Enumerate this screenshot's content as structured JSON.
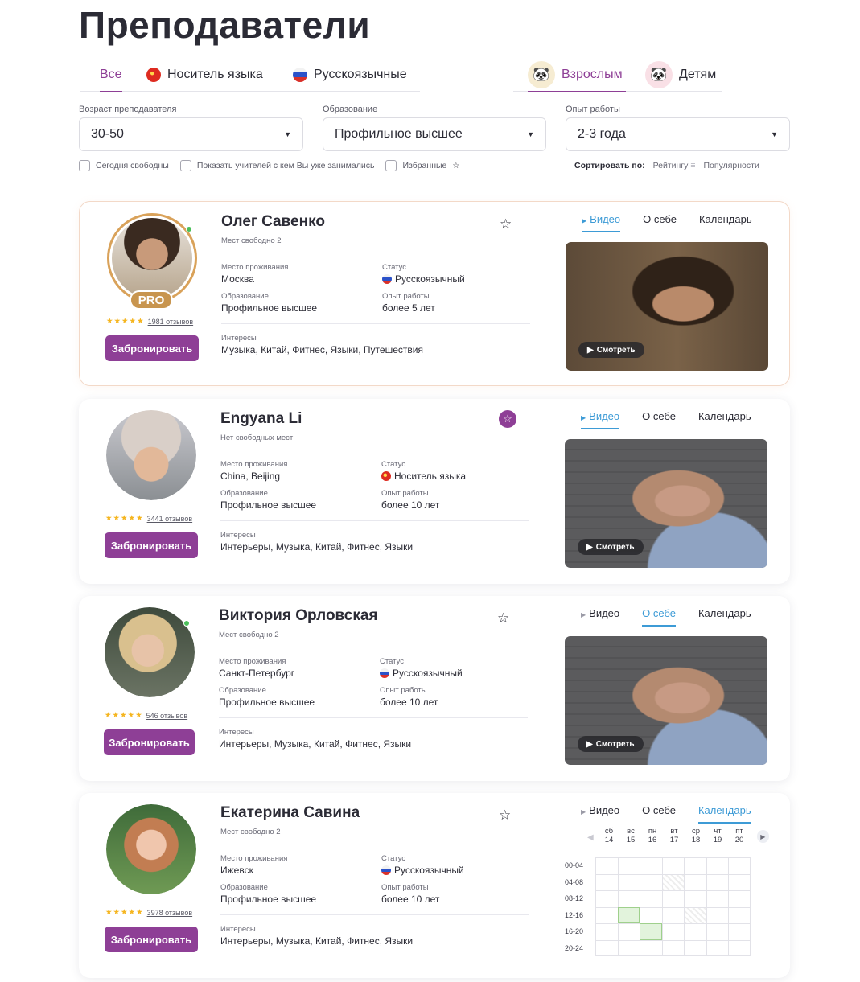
{
  "page_title": "Преподаватели",
  "tabs_left": [
    {
      "label": "Все",
      "active": true,
      "flag": ""
    },
    {
      "label": "Носитель языка",
      "active": false,
      "flag": "cn"
    },
    {
      "label": "Русскоязычные",
      "active": false,
      "flag": "ru"
    }
  ],
  "tabs_right": [
    {
      "label": "Взрослым",
      "active": true,
      "icon": "panda-adult-icon"
    },
    {
      "label": "Детям",
      "active": false,
      "icon": "panda-kid-icon"
    }
  ],
  "filters": {
    "age": {
      "label": "Возраст преподавателя",
      "value": "30-50"
    },
    "education": {
      "label": "Образование",
      "value": "Профильное высшее"
    },
    "experience": {
      "label": "Опыт работы",
      "value": "2-3 года"
    }
  },
  "checkboxes": {
    "free_today": "Сегодня свободны",
    "studied_before": "Показать учителей с кем Вы уже занимались",
    "favorites": "Избранные"
  },
  "sort": {
    "label": "Сортировать по:",
    "rating": "Рейтингу",
    "popularity": "Популярности"
  },
  "labels": {
    "residence": "Место проживания",
    "status": "Статус",
    "education": "Образование",
    "experience": "Опыт работы",
    "interests": "Интересы",
    "book": "Забронировать",
    "watch": "Смотреть",
    "tab_video": "Видео",
    "tab_about": "О себе",
    "tab_calendar": "Календарь"
  },
  "teachers": [
    {
      "name": "Олег Савенко",
      "slots": "Мест свободно 2",
      "pro": true,
      "pro_label": "PRO",
      "online": true,
      "favorite": false,
      "stars": "★★★★★",
      "reviews": "1981 отзывов",
      "residence": "Москва",
      "status": "Русскоязычный",
      "status_flag": "ru",
      "education": "Профильное высшее",
      "experience": "более 5 лет",
      "interests": "Музыка, Китай, Фитнес, Языки, Путешествия",
      "active_tab": "video"
    },
    {
      "name": "Engyana Li",
      "slots": "Нет свободных мест",
      "pro": false,
      "online": false,
      "favorite": true,
      "stars": "★★★★★",
      "reviews": "3441 отзывов",
      "residence": "China, Beijing",
      "status": "Носитель языка",
      "status_flag": "cn",
      "education": "Профильное высшее",
      "experience": "более 10 лет",
      "interests": "Интерьеры, Музыка, Китай, Фитнес, Языки",
      "active_tab": "video"
    },
    {
      "name": "Виктория Орловская",
      "slots": "Мест свободно 2",
      "pro": false,
      "online": true,
      "favorite": false,
      "stars": "★★★★★",
      "reviews": "546 отзывов",
      "residence": "Санкт-Петербург",
      "status": "Русскоязычный",
      "status_flag": "ru",
      "education": "Профильное высшее",
      "experience": "более 10 лет",
      "interests": "Интерьеры, Музыка, Китай, Фитнес, Языки",
      "active_tab": "about"
    },
    {
      "name": "Екатерина Савина",
      "slots": "Мест свободно 2",
      "pro": false,
      "online": false,
      "favorite": false,
      "stars": "★★★★★",
      "reviews": "3978 отзывов",
      "residence": "Ижевск",
      "status": "Русскоязычный",
      "status_flag": "ru",
      "education": "Профильное высшее",
      "experience": "более 10 лет",
      "interests": "Интерьеры, Музыка, Китай, Фитнес, Языки",
      "active_tab": "calendar"
    }
  ],
  "calendar": {
    "days": [
      {
        "wd": "сб",
        "d": "14"
      },
      {
        "wd": "вс",
        "d": "15"
      },
      {
        "wd": "пн",
        "d": "16"
      },
      {
        "wd": "вт",
        "d": "17"
      },
      {
        "wd": "ср",
        "d": "18"
      },
      {
        "wd": "чт",
        "d": "19"
      },
      {
        "wd": "пт",
        "d": "20"
      }
    ],
    "times": [
      "00-04",
      "04-08",
      "08-12",
      "12-16",
      "16-20",
      "20-24"
    ],
    "free": [
      [
        3,
        1
      ],
      [
        4,
        2
      ]
    ],
    "busy": [
      [
        1,
        3
      ],
      [
        3,
        4
      ]
    ]
  },
  "colors": {
    "accent": "#8e3f96",
    "link": "#3d9bd6",
    "star": "#f5b51f",
    "pro": "#c8954f"
  }
}
